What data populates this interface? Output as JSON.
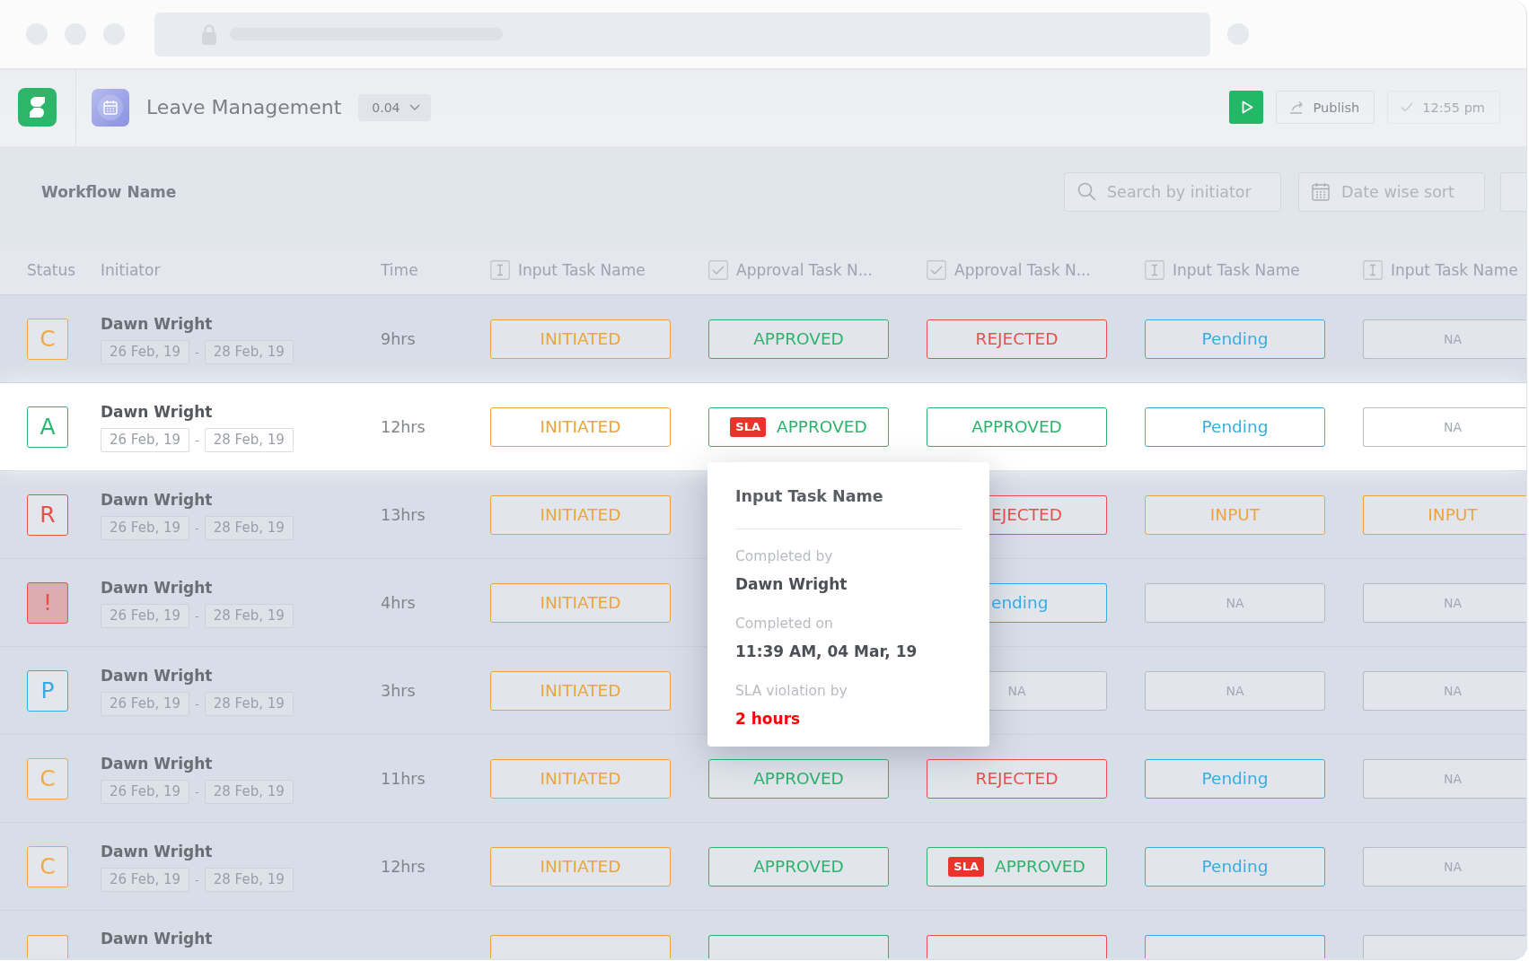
{
  "app_header": {
    "title": "Leave Management",
    "version": "0.04",
    "buttons": [
      {
        "kind": "run",
        "disabled": false
      },
      {
        "kind": "publish",
        "label": "Publish",
        "disabled": false
      },
      {
        "kind": "saved",
        "label": "12:55 pm",
        "disabled": true
      }
    ]
  },
  "toolbar": {
    "label": "Workflow Name",
    "search": {
      "placeholder": "Search by initiator"
    },
    "date_sort": {
      "placeholder": "Date wise sort"
    }
  },
  "table": {
    "columns": [
      {
        "label": "Status",
        "kind": "plain"
      },
      {
        "label": "Initiator",
        "kind": "plain"
      },
      {
        "label": "Time",
        "kind": "plain"
      },
      {
        "label": "Input Task Name",
        "kind": "input"
      },
      {
        "label": "Approval Task N...",
        "kind": "approval"
      },
      {
        "label": "Approval Task N...",
        "kind": "approval"
      },
      {
        "label": "Input Task Name",
        "kind": "input"
      },
      {
        "label": "Input Task Name",
        "kind": "input"
      }
    ],
    "rows": [
      {
        "selected": false,
        "status": {
          "letter": "C",
          "color": "#f0a941",
          "filled": false
        },
        "initiator": "Dawn Wright",
        "dates": [
          "26 Feb, 19",
          "28 Feb, 19"
        ],
        "separator": "-",
        "time": "9hrs",
        "tasks": [
          {
            "text": "INITIATED",
            "kind": "initiated",
            "covered": false
          },
          {
            "text": "APPROVED",
            "kind": "approved",
            "covered": false
          },
          {
            "text": "REJECTED",
            "kind": "rejected",
            "covered": false
          },
          {
            "text": "Pending",
            "kind": "pending",
            "covered": false
          },
          {
            "text": "NA",
            "kind": "na",
            "covered": false
          }
        ]
      },
      {
        "selected": true,
        "status": {
          "letter": "A",
          "color": "#2bb673",
          "filled": false
        },
        "initiator": "Dawn Wright",
        "dates": [
          "26 Feb, 19",
          "28 Feb, 19"
        ],
        "separator": "-",
        "time": "12hrs",
        "tasks": [
          {
            "text": "INITIATED",
            "kind": "initiated",
            "covered": false
          },
          {
            "text": "APPROVED",
            "kind": "approved",
            "flag": "SLA",
            "covered": false
          },
          {
            "text": "APPROVED",
            "kind": "approved",
            "covered": false
          },
          {
            "text": "Pending",
            "kind": "pending",
            "covered": false
          },
          {
            "text": "NA",
            "kind": "na",
            "covered": false
          }
        ]
      },
      {
        "selected": false,
        "status": {
          "letter": "R",
          "color": "#e8504a",
          "filled": false
        },
        "initiator": "Dawn Wright",
        "dates": [
          "26 Feb, 19",
          "28 Feb, 19"
        ],
        "separator": "-",
        "time": "13hrs",
        "tasks": [
          {
            "text": "INITIATED",
            "kind": "initiated",
            "covered": false
          },
          {
            "covered": true
          },
          {
            "text": "EJECTED",
            "kind": "rejected",
            "covered": true
          },
          {
            "text": "INPUT",
            "kind": "input",
            "covered": false
          },
          {
            "text": "INPUT",
            "kind": "input",
            "covered": false
          }
        ]
      },
      {
        "selected": false,
        "status": {
          "letter": "!",
          "color": "#e8504a",
          "filled": true
        },
        "initiator": "Dawn Wright",
        "dates": [
          "26 Feb, 19",
          "28 Feb, 19"
        ],
        "separator": "-",
        "time": "4hrs",
        "tasks": [
          {
            "text": "INITIATED",
            "kind": "initiated",
            "covered": false
          },
          {
            "covered": true
          },
          {
            "text": "ending",
            "kind": "pending",
            "covered": true
          },
          {
            "text": "NA",
            "kind": "na",
            "covered": false
          },
          {
            "text": "NA",
            "kind": "na",
            "covered": false
          }
        ]
      },
      {
        "selected": false,
        "status": {
          "letter": "P",
          "color": "#3aa9e0",
          "filled": false
        },
        "initiator": "Dawn Wright",
        "dates": [
          "26 Feb, 19",
          "28 Feb, 19"
        ],
        "separator": "-",
        "time": "3hrs",
        "tasks": [
          {
            "text": "INITIATED",
            "kind": "initiated",
            "covered": false
          },
          {
            "covered": true
          },
          {
            "text": "NA",
            "kind": "na",
            "covered": false
          },
          {
            "text": "NA",
            "kind": "na",
            "covered": false
          },
          {
            "text": "NA",
            "kind": "na",
            "covered": false
          }
        ]
      },
      {
        "selected": false,
        "status": {
          "letter": "C",
          "color": "#f0a941",
          "filled": false
        },
        "initiator": "Dawn Wright",
        "dates": [
          "26 Feb, 19",
          "28 Feb, 19"
        ],
        "separator": "-",
        "time": "11hrs",
        "tasks": [
          {
            "text": "INITIATED",
            "kind": "initiated",
            "covered": false
          },
          {
            "text": "APPROVED",
            "kind": "approved",
            "covered": false
          },
          {
            "text": "REJECTED",
            "kind": "rejected",
            "covered": false
          },
          {
            "text": "Pending",
            "kind": "pending",
            "covered": false
          },
          {
            "text": "NA",
            "kind": "na",
            "covered": false
          }
        ]
      },
      {
        "selected": false,
        "status": {
          "letter": "C",
          "color": "#f0a941",
          "filled": false
        },
        "initiator": "Dawn Wright",
        "dates": [
          "26 Feb, 19",
          "28 Feb, 19"
        ],
        "separator": "-",
        "time": "12hrs",
        "tasks": [
          {
            "text": "INITIATED",
            "kind": "initiated",
            "covered": false
          },
          {
            "text": "APPROVED",
            "kind": "approved",
            "covered": false
          },
          {
            "text": "APPROVED",
            "kind": "approved",
            "flag": "SLA",
            "covered": false
          },
          {
            "text": "Pending",
            "kind": "pending",
            "covered": false
          },
          {
            "text": "NA",
            "kind": "na",
            "covered": false
          }
        ]
      },
      {
        "selected": false,
        "status": {
          "color": "#f0a941",
          "filled": false
        },
        "initiator": "Dawn Wright",
        "tasks": [
          {
            "kind": "initiated",
            "covered": false
          },
          {
            "kind": "approved",
            "covered": false
          },
          {
            "kind": "rejected",
            "covered": false
          },
          {
            "kind": "pending",
            "covered": false
          },
          {
            "kind": "na",
            "covered": false
          }
        ]
      }
    ]
  },
  "tooltip": {
    "title": "Input Task Name",
    "fields": [
      {
        "label": "Completed by",
        "value": "Dawn Wright",
        "kind": "normal"
      },
      {
        "label": "Completed on",
        "value": "11:39 AM, 04 Mar, 19",
        "kind": "normal"
      },
      {
        "label": "SLA violation by",
        "value": "2 hours",
        "kind": "alert"
      }
    ]
  }
}
